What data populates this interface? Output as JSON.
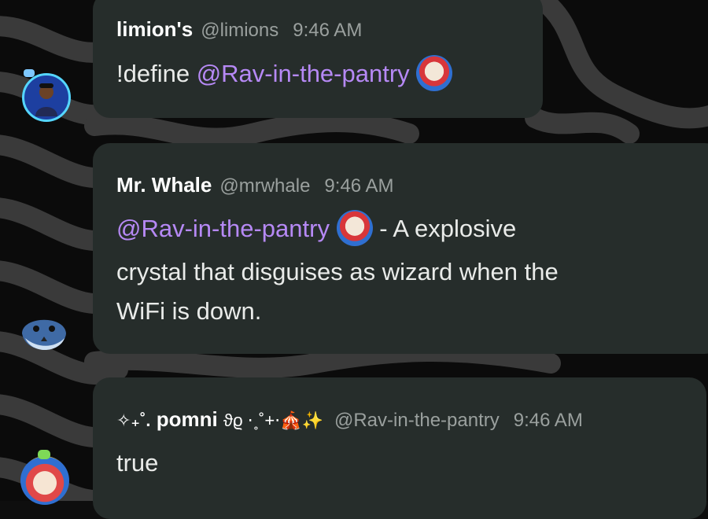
{
  "messages": [
    {
      "author": "limion's",
      "handle": "@limions",
      "time": "9:46 AM",
      "text_prefix": "!define ",
      "mention": "@Rav-in-the-pantry"
    },
    {
      "author": "Mr. Whale",
      "handle": "@mrwhale",
      "time": "9:46 AM",
      "mention": "@Rav-in-the-pantry",
      "line1_suffix": " - A explosive",
      "line2": "crystal that disguises as wizard when the",
      "line3": "WiFi is down."
    },
    {
      "author_prefix": "✧₊˚.",
      "author": "pomni",
      "author_suffix": "ϑϱ ⋅˳˚+⋅",
      "author_emojis": "🎪✨",
      "handle": "@Rav-in-the-pantry",
      "time": "9:46 AM",
      "text": "true"
    }
  ],
  "colors": {
    "background": "#0e0e0e",
    "bubble": "#262d2b",
    "mention": "#b689f5",
    "meta": "#9aa09e",
    "text": "#e9ebe9"
  },
  "icons": [
    "clown-avatar-icon",
    "user-avatar",
    "whale-avatar",
    "pomni-avatar"
  ]
}
